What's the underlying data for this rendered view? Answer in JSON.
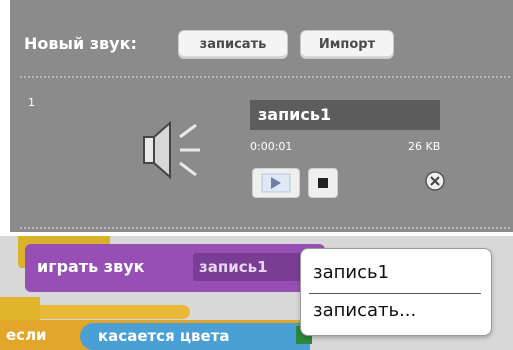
{
  "sound_panel": {
    "title": "Новый звук:",
    "record_button": "записать",
    "import_button": "Импорт",
    "index": "1",
    "sound_name": "запись1",
    "duration": "0:00:01",
    "size": "26 KB",
    "icons": [
      "speaker-icon",
      "play-icon",
      "stop-icon",
      "remove-icon"
    ]
  },
  "script": {
    "play_sound_label": "играть звук",
    "sound_slot_value": "запись1",
    "if_label": "если",
    "touching_color_label": "касается цвета",
    "touching_color": "#2b8a3a"
  },
  "dropdown": {
    "items": [
      "запись1",
      "записать..."
    ]
  },
  "colors": {
    "panel_bg": "#8b8b8b",
    "sound_block": "#974fb6",
    "control_block": "#e4a52b",
    "sensing_block": "#4a9fd4"
  }
}
